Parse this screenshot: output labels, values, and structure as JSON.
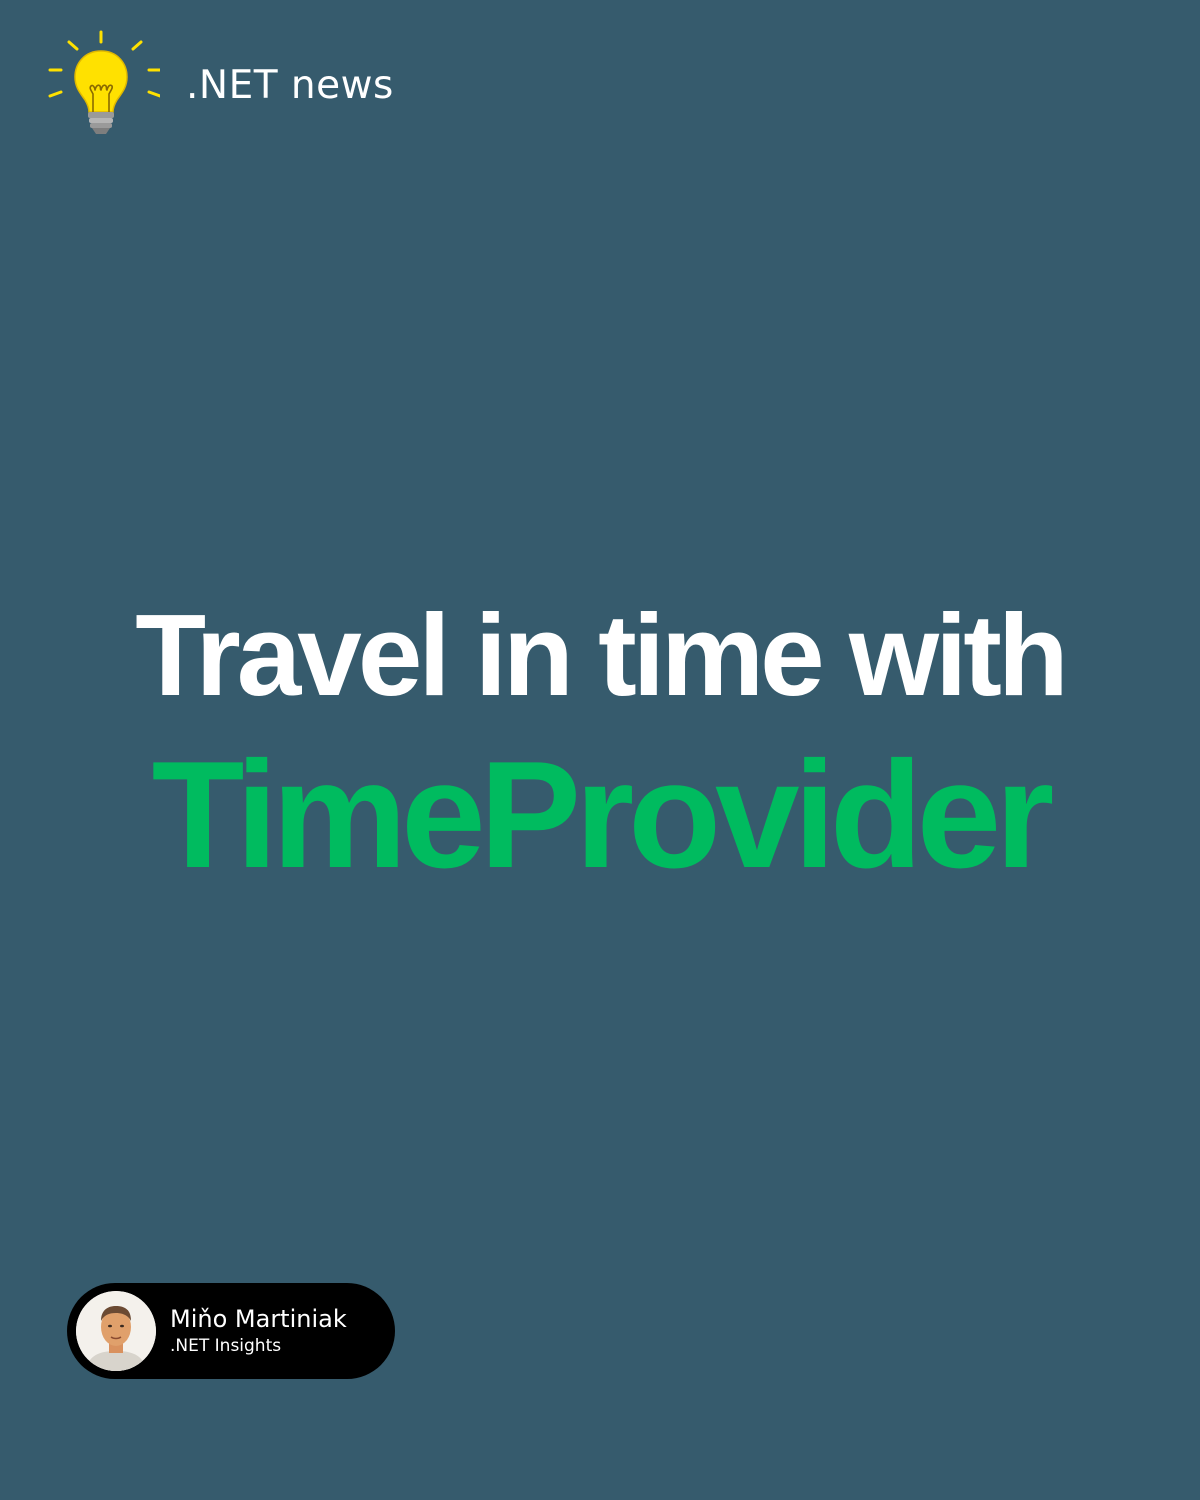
{
  "header": {
    "icon": "lightbulb-icon",
    "brand": ".NET news"
  },
  "headline": {
    "line1": "Travel in time with",
    "line2": "TimeProvider"
  },
  "author": {
    "avatar": "author-avatar",
    "name": "Miňo Martiniak",
    "role": ".NET Insights"
  },
  "colors": {
    "background": "#365B6D",
    "accent": "#00BB5F",
    "bulb": "#FFE100",
    "text": "#FFFFFF",
    "pill": "#000000"
  }
}
